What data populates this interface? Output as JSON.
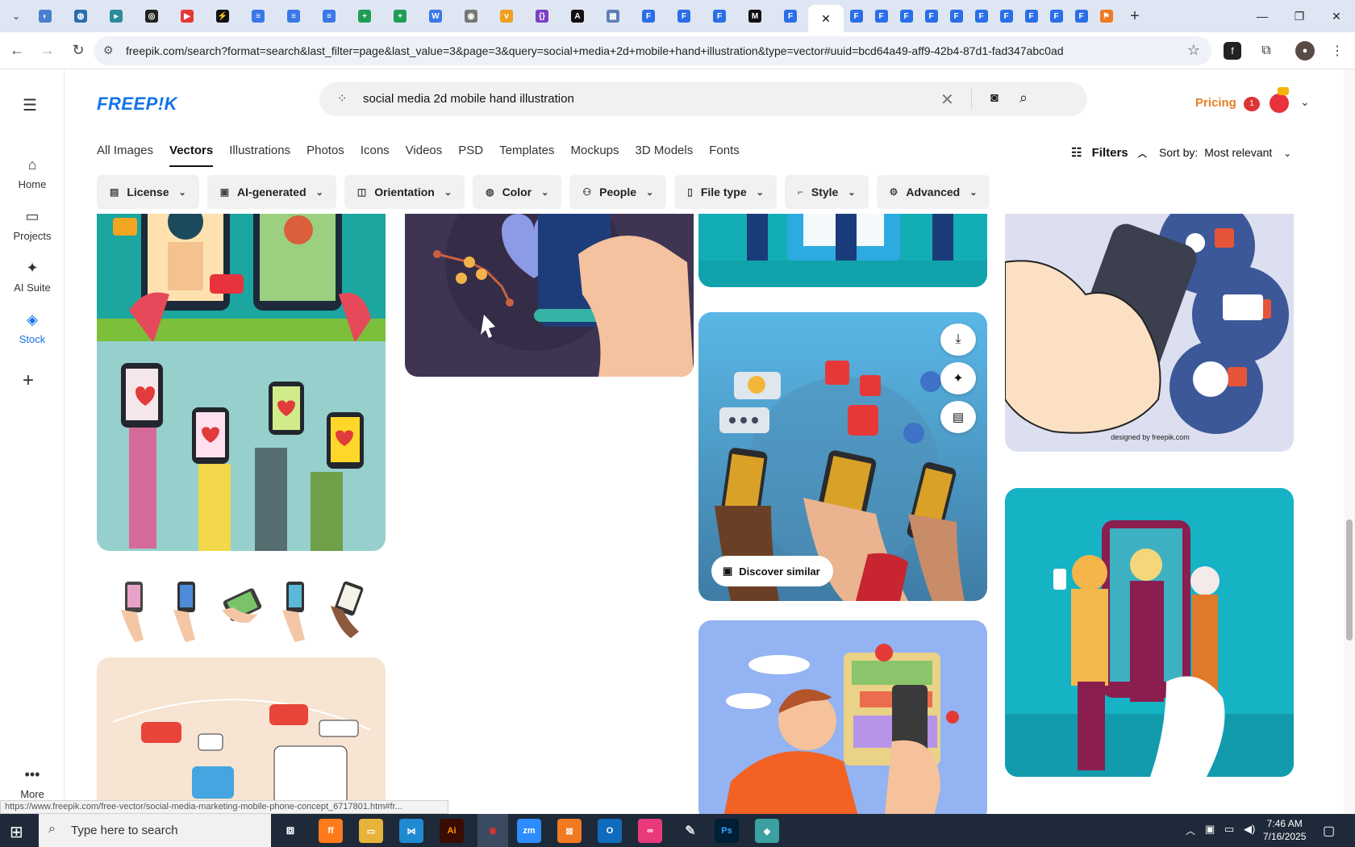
{
  "browser": {
    "url": "freepik.com/search?format=search&last_filter=page&last_value=3&page=3&query=social+media+2d+mobile+hand+illustration&type=vector#uuid=bcd64a49-aff9-42b4-87d1-fad347abc0ad",
    "hover_url": "https://www.freepik.com/free-vector/social-media-marketing-mobile-phone-concept_6717801.htm#fr..."
  },
  "rail": {
    "home": "Home",
    "projects": "Projects",
    "ai_suite": "AI Suite",
    "stock": "Stock",
    "more": "More"
  },
  "header": {
    "logo": "FREEP!K",
    "search_query": "social media 2d mobile hand illustration",
    "pricing": "Pricing",
    "notification_count": "1"
  },
  "type_tabs": [
    "All Images",
    "Vectors",
    "Illustrations",
    "Photos",
    "Icons",
    "Videos",
    "PSD",
    "Templates",
    "Mockups",
    "3D Models",
    "Fonts"
  ],
  "active_tab": "Vectors",
  "filters_label": "Filters",
  "sort": {
    "label": "Sort by:",
    "value": "Most relevant"
  },
  "chips": [
    "License",
    "AI-generated",
    "Orientation",
    "Color",
    "People",
    "File type",
    "Style",
    "Advanced"
  ],
  "hover_card": {
    "discover": "Discover similar"
  },
  "watermark": "designed by freepik.com",
  "taskbar": {
    "search_placeholder": "Type here to search",
    "time": "7:46 AM",
    "date": "7/16/2025"
  },
  "colors": {
    "brand": "#1273eb",
    "pricing": "#e67e22",
    "taskbar": "#1e2a3a"
  }
}
